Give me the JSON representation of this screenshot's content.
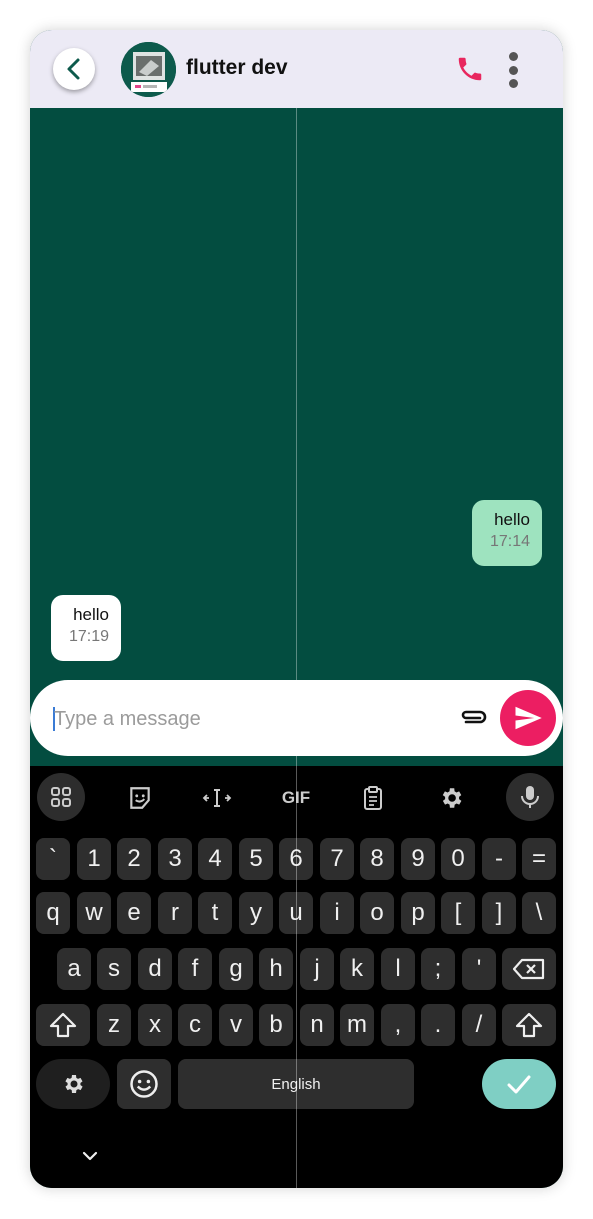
{
  "header": {
    "title": "flutter dev",
    "back_icon": "chevron-left-icon",
    "call_icon": "phone-icon",
    "menu_icon": "more-vertical-icon",
    "call_color": "#e8275e"
  },
  "messages": [
    {
      "direction": "outgoing",
      "text": "hello",
      "time": "17:14"
    },
    {
      "direction": "incoming",
      "text": "hello",
      "time": "17:19"
    }
  ],
  "composer": {
    "placeholder": "Type a message",
    "value": "",
    "attach_icon": "paperclip-icon",
    "send_icon": "send-icon",
    "send_color": "#ec1e62"
  },
  "keyboard": {
    "toolbar": [
      "apps-grid-icon",
      "sticker-icon",
      "cursor-move-icon",
      "GIF",
      "clipboard-icon",
      "gear-icon",
      "mic-icon"
    ],
    "row1": [
      "`",
      "1",
      "2",
      "3",
      "4",
      "5",
      "6",
      "7",
      "8",
      "9",
      "0",
      "-",
      "="
    ],
    "row2": [
      "q",
      "w",
      "e",
      "r",
      "t",
      "y",
      "u",
      "i",
      "o",
      "p",
      "[",
      "]",
      "\\"
    ],
    "row3": [
      "a",
      "s",
      "d",
      "f",
      "g",
      "h",
      "j",
      "k",
      "l",
      ";",
      "'"
    ],
    "row4": [
      "z",
      "x",
      "c",
      "v",
      "b",
      "n",
      "m",
      ",",
      ".",
      "/"
    ],
    "space_label": "English",
    "enter_icon": "check-icon",
    "enter_color": "#7fcfc4"
  }
}
